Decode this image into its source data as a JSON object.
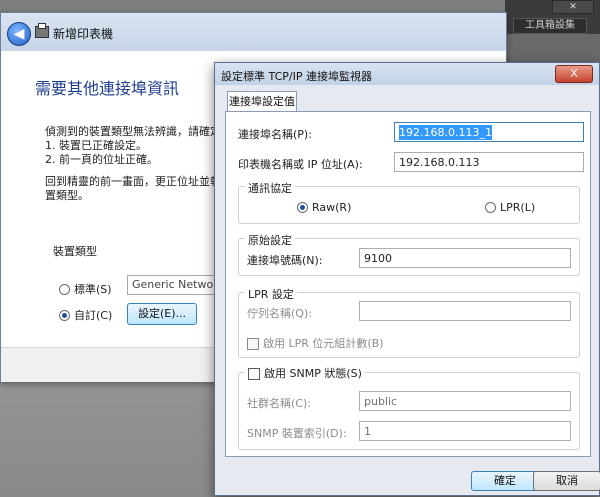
{
  "background": {
    "tab_label": "工具箱設集"
  },
  "wizard": {
    "title": "新增印表機",
    "heading": "需要其他連接埠資訊",
    "lines": [
      "偵測到的裝置類型無法辨識，請確定:",
      "1. 裝置已正確設定。",
      "2. 前一頁的位址正確。",
      "回到精靈的前一畫面，更正位址並執行新",
      "置類型。"
    ],
    "device_type_label": "裝置類型",
    "radio_standard": "標準(S)",
    "radio_custom": "自訂(C)",
    "device_select_value": "Generic Network C",
    "settings_button": "設定(E)..."
  },
  "dialog": {
    "title": "設定標準 TCP/IP 連接埠監視器",
    "close_label": "X",
    "tab_label": "連接埠設定值",
    "port_name_label": "連接埠名稱(P):",
    "port_name_value": "192.168.0.113_1",
    "printer_ip_label": "印表機名稱或 IP 位址(A):",
    "printer_ip_value": "192.168.0.113",
    "protocol_group": "通訊協定",
    "raw_label": "Raw(R)",
    "lpr_label": "LPR(L)",
    "raw_group": "原始設定",
    "port_number_label": "連接埠號碼(N):",
    "port_number_value": "9100",
    "lpr_group": "LPR 設定",
    "queue_name_label": "佇列名稱(Q):",
    "queue_name_value": "",
    "lpr_byte_count_label": "啟用 LPR 位元組計數(B)",
    "snmp_enable_label": "啟用 SNMP 狀態(S)",
    "community_label": "社群名稱(C):",
    "community_value": "public",
    "snmp_index_label": "SNMP 裝置索引(D):",
    "snmp_index_value": "1",
    "ok_button": "確定",
    "cancel_button": "取消"
  },
  "selection": {
    "protocol": "Raw(R)",
    "device_type": "自訂(C)"
  }
}
